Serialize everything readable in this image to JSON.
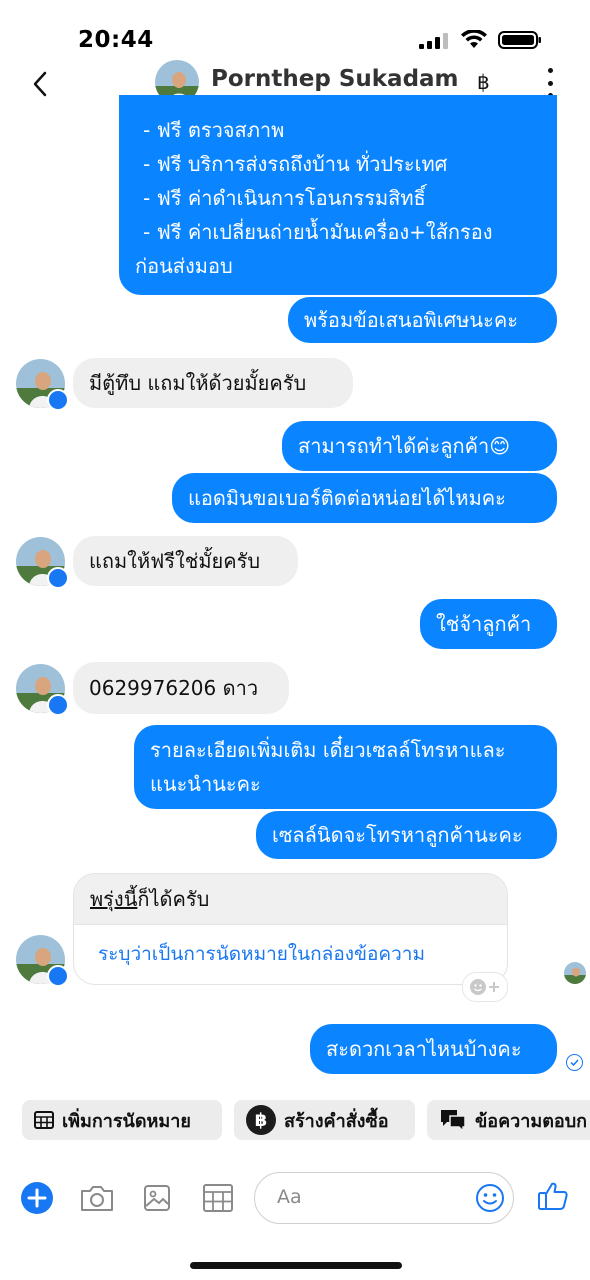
{
  "status_bar": {
    "time": "20:44"
  },
  "header": {
    "contact_name": "Pornthep Sukadam",
    "baht_symbol": "฿"
  },
  "messages": {
    "m1_lines": [
      "- ฟรี ตรวจสภาพ",
      "- ฟรี บริการส่งรถถึงบ้าน ทั่วประเทศ",
      "- ฟรี ค่าดำเนินการโอนกรรมสิทธิ์",
      "- ฟรี ค่าเปลี่ยนถ่ายน้ำมันเครื่อง+ใส้กรอง",
      "ก่อนส่งมอบ"
    ],
    "m2": "พร้อมข้อเสนอพิเศษนะคะ",
    "m3": "มีตู้ทึบ แถมให้ด้วยมั้ยครับ",
    "m4": "สามารถทำได้ค่ะลูกค้า😊",
    "m5": "แอดมินขอเบอร์ติดต่อหน่อยได้ไหมคะ",
    "m6": "แถมให้ฟรีใช่มั้ยครับ",
    "m7": "ใช่จ้าลูกค้า",
    "m8": "0629976206 ดาว",
    "m9_lines": [
      "รายละเอียดเพิ่มเติม เดี๋ยวเซลล์โทรหาและ",
      "แนะนำนะคะ"
    ],
    "m10": "เซลล์นิดจะโทรหาลูกค้านะคะ",
    "m11_underlined": "พรุ่งนี้",
    "m11_rest": "ก็ได้ครับ",
    "m11_link": "ระบุว่าเป็นการนัดหมายในกล่องข้อความ",
    "m12": "สะดวกเวลาไหนบ้างคะ"
  },
  "quick_actions": {
    "appointment": "เพิ่มการนัดหมาย",
    "order": "สร้างคำสั่งซื้อ",
    "order_icon_text": "฿",
    "saved_replies": "ข้อความตอบก"
  },
  "composer": {
    "placeholder": "Aa"
  },
  "colors": {
    "accent": "#0a84ff",
    "incoming": "#efefef",
    "link": "#1877f2"
  }
}
